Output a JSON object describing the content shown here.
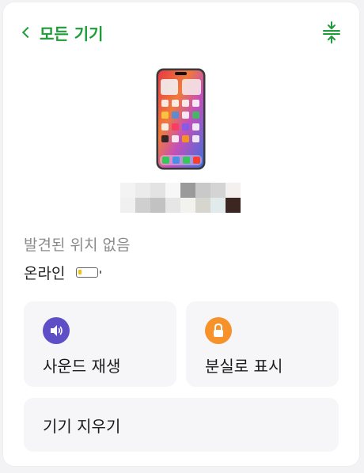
{
  "header": {
    "back_label": "모든 기기"
  },
  "device": {
    "status_text": "발견된 위치 없음",
    "connection_text": "온라인",
    "battery_level": 0.2,
    "battery_color": "#f5c400"
  },
  "actions": {
    "play_sound": {
      "label": "사운드 재생",
      "icon": "speaker-icon",
      "color": "#5e4fc7"
    },
    "mark_lost": {
      "label": "분실로 표시",
      "icon": "lock-icon",
      "color": "#f7922b"
    },
    "erase": {
      "label": "기기 지우기"
    }
  },
  "colors": {
    "accent": "#1f9c3a"
  }
}
